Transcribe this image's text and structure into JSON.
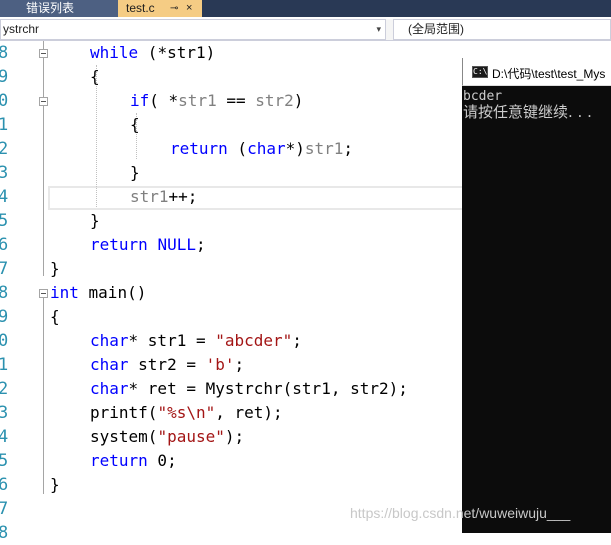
{
  "tabs": [
    {
      "label": "错误列表"
    },
    {
      "label": "test.c",
      "pin": "⊸",
      "close": "×"
    }
  ],
  "navbar": {
    "left_value": "ystrchr",
    "right_value": "(全局范围)"
  },
  "line_numbers": [
    "8",
    "9",
    "0",
    "1",
    "2",
    "3",
    "4",
    "5",
    "6",
    "7",
    "8",
    "9",
    "0",
    "1",
    "2",
    "3",
    "4",
    "5",
    "6",
    "7",
    "8"
  ],
  "code": {
    "l1": {
      "kw": "while",
      "rest": " (*str1)"
    },
    "l2": "{",
    "l3": {
      "kw": "if",
      "rest1": "( *",
      "id1": "str1",
      "rest2": " == ",
      "id2": "str2",
      "rest3": ")"
    },
    "l4": "{",
    "l5": {
      "kw": "return",
      "rest1": " (",
      "kw2": "char",
      "rest2": "*)",
      "id": "str1",
      "rest3": ";"
    },
    "l6": "}",
    "l7": {
      "id": "str1",
      "rest": "++;"
    },
    "l8": "}",
    "l9": {
      "kw": "return",
      "rest": " ",
      "macro": "NULL",
      "end": ";"
    },
    "l10": "}",
    "l11": {
      "kw": "int",
      "rest": " main()"
    },
    "l12": "{",
    "l13": {
      "kw": "char",
      "rest": "* str1 = ",
      "str": "\"abcder\"",
      "end": ";"
    },
    "l14": {
      "kw": "char",
      "rest": " str2 = ",
      "str": "'b'",
      "end": ";"
    },
    "l15": {
      "kw": "char",
      "rest": "* ret = Mystrchr(str1, str2);"
    },
    "l16": {
      "fn": "printf(",
      "str": "\"%s\\n\"",
      "rest": ", ret);"
    },
    "l17": {
      "fn": "system(",
      "str": "\"pause\"",
      "rest": ");"
    },
    "l18": {
      "kw": "return",
      "rest": " 0;"
    },
    "l19": "}"
  },
  "console": {
    "title": "D:\\代码\\test\\test_Mys",
    "icon_label": "C:\\",
    "output_line1": "bcder",
    "output_line2": "请按任意键继续. . ."
  },
  "watermark": "https://blog.csdn.net/wuweiwuju___"
}
